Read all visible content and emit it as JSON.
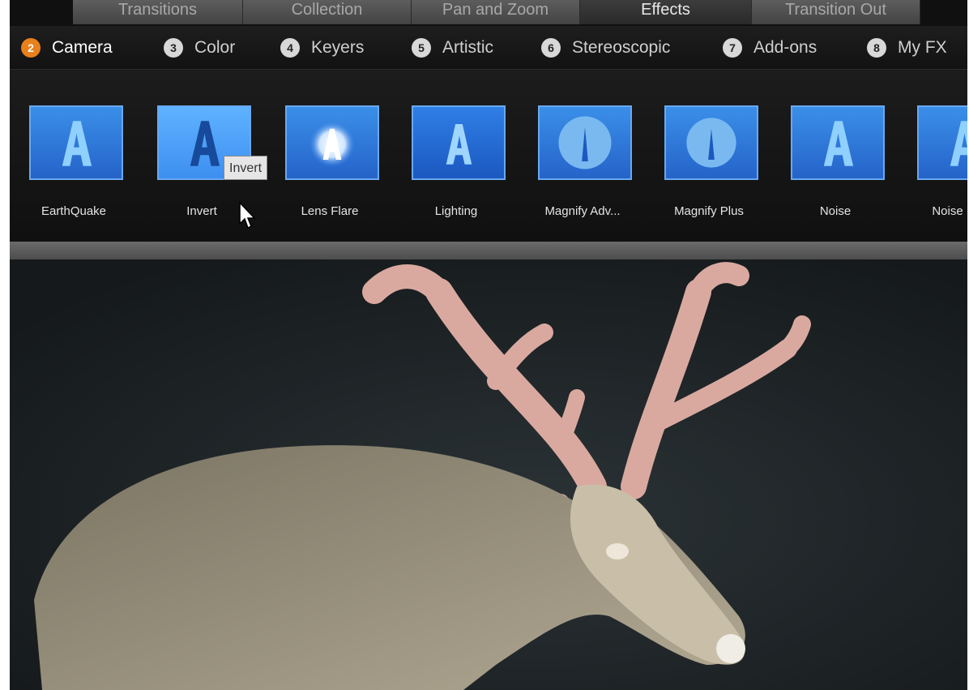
{
  "top_tabs": [
    {
      "label": "Transitions"
    },
    {
      "label": "Collection"
    },
    {
      "label": "Pan and Zoom"
    },
    {
      "label": "Effects"
    },
    {
      "label": "Transition Out"
    }
  ],
  "categories": [
    {
      "num": "2",
      "label": "Camera",
      "active": true
    },
    {
      "num": "3",
      "label": "Color"
    },
    {
      "num": "4",
      "label": "Keyers"
    },
    {
      "num": "5",
      "label": "Artistic"
    },
    {
      "num": "6",
      "label": "Stereoscopic"
    },
    {
      "num": "7",
      "label": "Add-ons"
    },
    {
      "num": "8",
      "label": "My FX"
    }
  ],
  "effects": [
    {
      "label": "EarthQuake",
      "icon": "letter-a-icon"
    },
    {
      "label": "Invert",
      "icon": "letter-a-inverted-icon",
      "selected": true
    },
    {
      "label": "Lens Flare",
      "icon": "lens-flare-icon"
    },
    {
      "label": "Lighting",
      "icon": "letter-a-icon"
    },
    {
      "label": "Magnify Adv...",
      "icon": "magnify-icon"
    },
    {
      "label": "Magnify Plus",
      "icon": "magnify-icon"
    },
    {
      "label": "Noise",
      "icon": "letter-a-icon"
    },
    {
      "label": "Noise R",
      "icon": "letter-a-icon"
    }
  ],
  "tooltip": {
    "text": "Invert"
  },
  "colors": {
    "accent": "#e8801c",
    "thumb_blue": "#2f7ae0"
  }
}
